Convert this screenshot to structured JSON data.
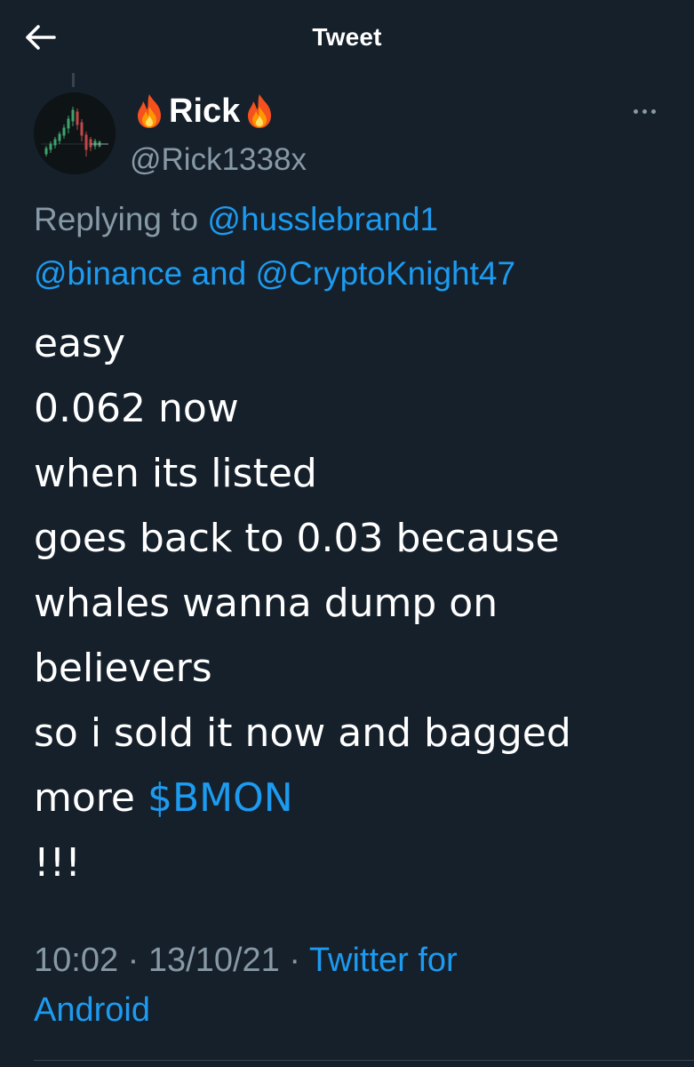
{
  "header": {
    "title": "Tweet",
    "back_icon": "arrow-left-icon"
  },
  "author": {
    "display_name": "Rick",
    "name_emoji_left": "fire-emoji",
    "name_emoji_right": "fire-emoji",
    "handle": "@Rick1338x",
    "more_icon": "more-dots-icon"
  },
  "reply": {
    "prefix": "Replying to",
    "mention_1": "@husslebrand1",
    "mention_2": "@binance",
    "joiner": "and",
    "mention_3": "@CryptoKnight47"
  },
  "tweet": {
    "lines": [
      "easy",
      "0.062 now",
      "when its listed",
      "goes back to 0.03 because",
      "whales wanna dump on",
      "believers",
      "so i sold it now and bagged"
    ],
    "line_8_prefix": "more",
    "cashtag": "$BMON",
    "last_line": "!!!"
  },
  "meta": {
    "time": "10:02",
    "separator": "·",
    "date": "13/10/21",
    "source_line_1": "Twitter for",
    "source_line_2": "Android"
  },
  "colors": {
    "background": "#15202b",
    "text": "#ffffff",
    "secondary": "#8899a6",
    "accent": "#1d9bf0"
  }
}
